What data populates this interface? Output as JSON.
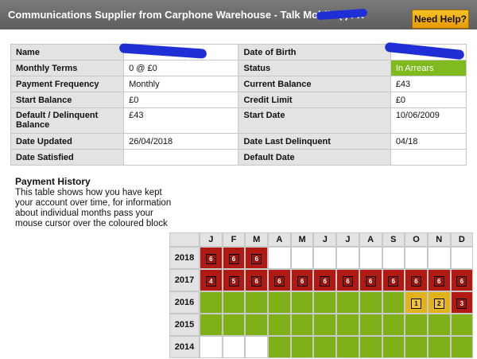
{
  "header": {
    "title": "Communications Supplier from Carphone Warehouse - Talk Mobile (I) / X",
    "help_label": "Need Help?"
  },
  "details": {
    "rows": [
      [
        {
          "label": "Name",
          "value": ""
        },
        {
          "label": "Date of Birth",
          "value": ""
        }
      ],
      [
        {
          "label": "Monthly Terms",
          "value": "0 @ £0"
        },
        {
          "label": "Status",
          "value": "In Arrears"
        }
      ],
      [
        {
          "label": "Payment Frequency",
          "value": "Monthly"
        },
        {
          "label": "Current Balance",
          "value": "£43"
        }
      ],
      [
        {
          "label": "Start Balance",
          "value": "£0"
        },
        {
          "label": "Credit Limit",
          "value": "£0"
        }
      ],
      [
        {
          "label": "Default / Delinquent Balance",
          "value": "£43"
        },
        {
          "label": "Start Date",
          "value": "10/06/2009"
        }
      ],
      [
        {
          "label": "Date Updated",
          "value": "26/04/2018"
        },
        {
          "label": "Date Last Delinquent",
          "value": "04/18"
        }
      ],
      [
        {
          "label": "Date Satisfied",
          "value": ""
        },
        {
          "label": "Default Date",
          "value": ""
        }
      ]
    ]
  },
  "payment_history": {
    "title": "Payment History",
    "description": "This table shows how you have kept your account over time, for information about individual months pass your mouse cursor over the coloured block",
    "months": [
      "J",
      "F",
      "M",
      "A",
      "M",
      "J",
      "J",
      "A",
      "S",
      "O",
      "N",
      "D"
    ],
    "years": [
      {
        "year": "2018",
        "cells": [
          {
            "c": "red",
            "v": "6"
          },
          {
            "c": "red",
            "v": "6"
          },
          {
            "c": "red",
            "v": "6"
          },
          {
            "c": "blank",
            "v": ""
          },
          {
            "c": "blank",
            "v": ""
          },
          {
            "c": "blank",
            "v": ""
          },
          {
            "c": "blank",
            "v": ""
          },
          {
            "c": "blank",
            "v": ""
          },
          {
            "c": "blank",
            "v": ""
          },
          {
            "c": "blank",
            "v": ""
          },
          {
            "c": "blank",
            "v": ""
          },
          {
            "c": "blank",
            "v": ""
          }
        ]
      },
      {
        "year": "2017",
        "cells": [
          {
            "c": "red",
            "v": "4"
          },
          {
            "c": "red",
            "v": "5"
          },
          {
            "c": "red",
            "v": "6"
          },
          {
            "c": "red",
            "v": "6"
          },
          {
            "c": "red",
            "v": "6"
          },
          {
            "c": "red",
            "v": "6"
          },
          {
            "c": "red",
            "v": "6"
          },
          {
            "c": "red",
            "v": "6"
          },
          {
            "c": "red",
            "v": "6"
          },
          {
            "c": "red",
            "v": "6"
          },
          {
            "c": "red",
            "v": "6"
          },
          {
            "c": "red",
            "v": "6"
          }
        ]
      },
      {
        "year": "2016",
        "cells": [
          {
            "c": "green",
            "v": ""
          },
          {
            "c": "green",
            "v": ""
          },
          {
            "c": "green",
            "v": ""
          },
          {
            "c": "green",
            "v": ""
          },
          {
            "c": "green",
            "v": ""
          },
          {
            "c": "green",
            "v": ""
          },
          {
            "c": "green",
            "v": ""
          },
          {
            "c": "green",
            "v": ""
          },
          {
            "c": "green",
            "v": ""
          },
          {
            "c": "amber",
            "v": "1"
          },
          {
            "c": "amber",
            "v": "2"
          },
          {
            "c": "red",
            "v": "3"
          }
        ]
      },
      {
        "year": "2015",
        "cells": [
          {
            "c": "green",
            "v": ""
          },
          {
            "c": "green",
            "v": ""
          },
          {
            "c": "green",
            "v": ""
          },
          {
            "c": "green",
            "v": ""
          },
          {
            "c": "green",
            "v": ""
          },
          {
            "c": "green",
            "v": ""
          },
          {
            "c": "green",
            "v": ""
          },
          {
            "c": "green",
            "v": ""
          },
          {
            "c": "green",
            "v": ""
          },
          {
            "c": "green",
            "v": ""
          },
          {
            "c": "green",
            "v": ""
          },
          {
            "c": "green",
            "v": ""
          }
        ]
      },
      {
        "year": "2014",
        "cells": [
          {
            "c": "blank",
            "v": ""
          },
          {
            "c": "blank",
            "v": ""
          },
          {
            "c": "blank",
            "v": ""
          },
          {
            "c": "green",
            "v": ""
          },
          {
            "c": "green",
            "v": ""
          },
          {
            "c": "green",
            "v": ""
          },
          {
            "c": "green",
            "v": ""
          },
          {
            "c": "green",
            "v": ""
          },
          {
            "c": "green",
            "v": ""
          },
          {
            "c": "green",
            "v": ""
          },
          {
            "c": "green",
            "v": ""
          },
          {
            "c": "green",
            "v": ""
          }
        ]
      }
    ]
  },
  "colors": {
    "header_bg": "#6a6a6a",
    "help_button": "#f0b21a",
    "status_green": "#7fba1e",
    "late_red": "#b11a12",
    "ok_green": "#7fb018",
    "early_amber": "#e1b21c"
  }
}
